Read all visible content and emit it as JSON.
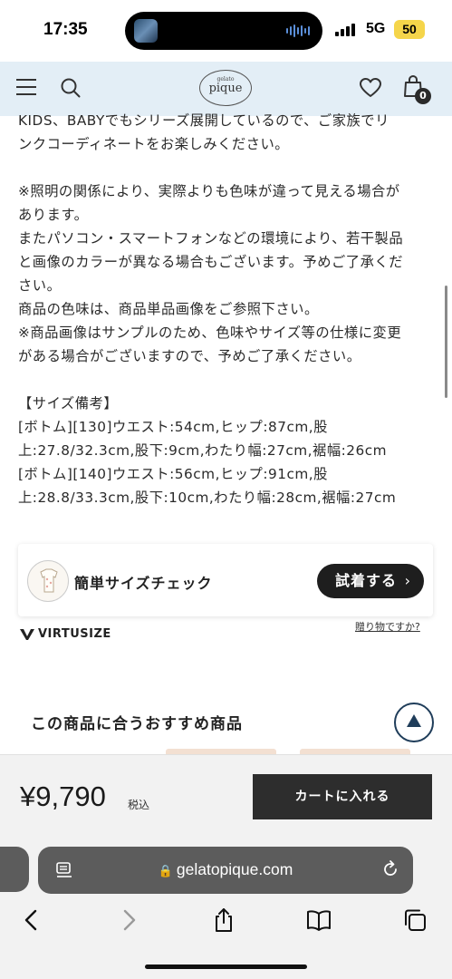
{
  "status_bar": {
    "time": "17:35",
    "network": "5G",
    "battery": "50"
  },
  "header": {
    "logo_small": "gelato",
    "logo_main": "pique",
    "cart_count": "0"
  },
  "description": {
    "lines_a": [
      "KIDS、BABYでもシリーズ展開しているので、ご家族でリ",
      "ンクコーディネートをお楽しみください。"
    ],
    "lines_b": [
      "※照明の関係により、実際よりも色味が違って見える場合が",
      "あります。",
      "またパソコン・スマートフォンなどの環境により、若干製品",
      "と画像のカラーが異なる場合もございます。予めご了承くだ",
      "さい。",
      "商品の色味は、商品単品画像をご参照下さい。",
      "※商品画像はサンプルのため、色味やサイズ等の仕様に変更",
      "がある場合がございますので、予めご了承ください。"
    ],
    "lines_c": [
      "【サイズ備考】",
      "[ボトム][130]ウエスト:54cm,ヒップ:87cm,股",
      "上:27.8/32.3cm,股下:9cm,わたり幅:27cm,裾幅:26cm",
      "[ボトム][140]ウエスト:56cm,ヒップ:91cm,股",
      "上:28.8/33.3cm,股下:10cm,わたり幅:28cm,裾幅:27cm"
    ]
  },
  "virtusize": {
    "label": "簡単サイズチェック",
    "button_label": "試着する",
    "brand": "VIRTUSIZE",
    "gift_link": "贈り物ですか?"
  },
  "recommend": {
    "title": "この商品に合うおすすめ商品"
  },
  "purchase": {
    "price": "¥9,790",
    "tax_label": "税込",
    "cart_button": "カートに入れる"
  },
  "browser": {
    "url": "gelatopique.com"
  },
  "icons": [
    "menu-icon",
    "search-icon",
    "heart-icon",
    "bag-icon",
    "chevron-right-icon",
    "arrow-up-icon",
    "lock-icon",
    "reader-icon",
    "reload-icon",
    "back-icon",
    "forward-icon",
    "share-icon",
    "bookmarks-icon",
    "tabs-icon"
  ],
  "colors": {
    "header_bg": "#e3eef6",
    "button_dark": "#2d2d2d",
    "accent_navy": "#1f3d5a",
    "battery": "#f5d54a"
  }
}
